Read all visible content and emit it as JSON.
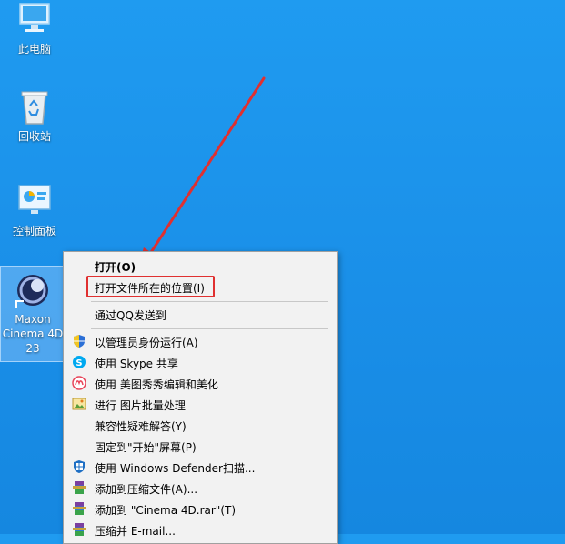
{
  "desktop": {
    "icons": [
      {
        "label": "此电脑"
      },
      {
        "label": "回收站"
      },
      {
        "label": "控制面板"
      },
      {
        "label": "Maxon Cinema 4D 23"
      }
    ]
  },
  "context_menu": {
    "items": {
      "open": "打开(O)",
      "open_location": "打开文件所在的位置(I)",
      "qq_send": "通过QQ发送到",
      "run_as_admin": "以管理员身份运行(A)",
      "skype_share": "使用 Skype 共享",
      "meitu": "使用 美图秀秀编辑和美化",
      "batch_image": "进行 图片批量处理",
      "compat": "兼容性疑难解答(Y)",
      "pin_start": "固定到\"开始\"屏幕(P)",
      "defender": "使用 Windows Defender扫描...",
      "add_archive": "添加到压缩文件(A)...",
      "add_rar": "添加到 \"Cinema 4D.rar\"(T)",
      "compress_email": "压缩并 E-mail..."
    }
  },
  "colors": {
    "desktop_bg": "#1a8fe8",
    "highlight_box": "#e03030",
    "arrow": "#e03030"
  }
}
